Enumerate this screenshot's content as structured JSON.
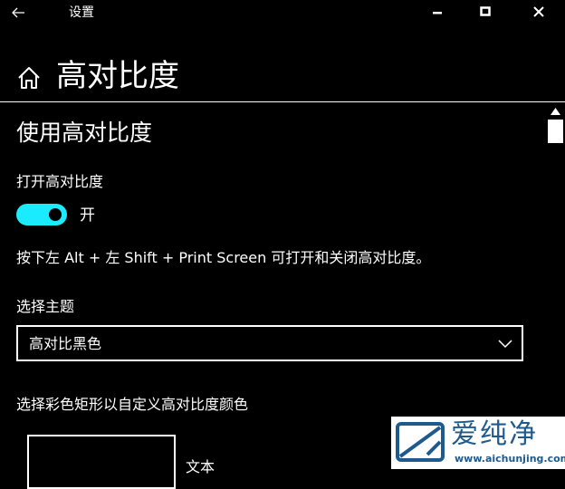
{
  "window": {
    "title": "设置"
  },
  "header": {
    "title": "高对比度"
  },
  "main": {
    "section_title": "使用高对比度",
    "toggle": {
      "label": "打开高对比度",
      "state": "开",
      "on": true
    },
    "shortcut_hint": "按下左 Alt + 左 Shift + Print Screen 可打开和关闭高对比度。",
    "theme": {
      "label": "选择主题",
      "selected": "高对比黑色"
    },
    "color_section": {
      "label": "选择彩色矩形以自定义高对比度颜色",
      "swatches": [
        {
          "label": "文本"
        }
      ]
    }
  },
  "watermark": {
    "name": "爱纯净",
    "url": "www.aichunjing.com"
  },
  "colors": {
    "background": "#000000",
    "foreground": "#ffffff",
    "toggle_on": "#1aebff",
    "watermark_text": "#1e5a8c"
  },
  "icons": {
    "back": "back-arrow-icon",
    "minimize": "minimize-icon",
    "maximize": "maximize-icon",
    "close": "close-icon",
    "home": "home-icon",
    "dropdown": "chevron-down-icon"
  }
}
